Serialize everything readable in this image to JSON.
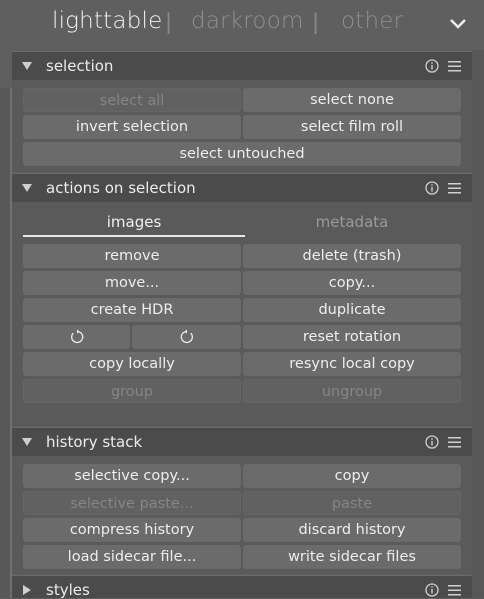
{
  "views": {
    "lighttable": "lighttable",
    "darkroom": "darkroom",
    "other": "other",
    "separator": "|",
    "expand_icon": "chevron-down-icon"
  },
  "selection": {
    "title": "selection",
    "buttons": {
      "select_all": "select all",
      "select_none": "select none",
      "invert_selection": "invert selection",
      "select_film_roll": "select film roll",
      "select_untouched": "select untouched"
    }
  },
  "actions": {
    "title": "actions on selection",
    "tabs": [
      "images",
      "metadata"
    ],
    "active_tab": "images",
    "buttons": {
      "remove": "remove",
      "delete": "delete (trash)",
      "move": "move...",
      "copy": "copy...",
      "create_hdr": "create HDR",
      "duplicate": "duplicate",
      "rotate_ccw_icon": "rotate-ccw-icon",
      "rotate_cw_icon": "rotate-cw-icon",
      "reset_rotation": "reset rotation",
      "copy_locally": "copy locally",
      "resync_local_copy": "resync local copy",
      "group": "group",
      "ungroup": "ungroup"
    }
  },
  "history": {
    "title": "history stack",
    "buttons": {
      "selective_copy": "selective copy...",
      "copy": "copy",
      "selective_paste": "selective paste...",
      "paste": "paste",
      "compress_history": "compress history",
      "discard_history": "discard history",
      "load_sidecar": "load sidecar file...",
      "write_sidecar": "write sidecar files"
    }
  },
  "styles": {
    "title": "styles"
  },
  "colors": {
    "background": "#5f5f5f",
    "header": "#4b4b4b",
    "button": "#6b6b6b",
    "text": "#eeeeee",
    "dim_text": "#8c8c8c"
  }
}
